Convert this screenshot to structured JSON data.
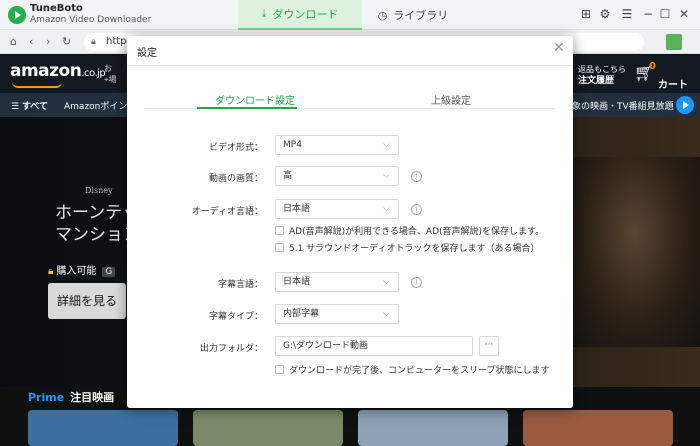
{
  "app": {
    "name": "TuneBoto",
    "subtitle": "Amazon Video Downloader",
    "tabs": [
      {
        "label": "ダウンロード",
        "icon": "download-icon",
        "active": true
      },
      {
        "label": "ライブラリ",
        "icon": "clock-icon",
        "active": false
      }
    ],
    "window_icons": [
      "grid-icon",
      "gear-icon",
      "menu-icon",
      "minimize-icon",
      "maximize-icon",
      "close-icon"
    ],
    "accent_color": "#22a84a"
  },
  "browser": {
    "url": "https:"
  },
  "amazon": {
    "logo": "amazon",
    "logo_suffix": ".co.jp",
    "deliver_prefix": "お",
    "deliver_line2": "場",
    "orders_line1": "返品もこちら",
    "orders_line2": "注文履歴",
    "cart_count": "0",
    "cart_label": "カート",
    "nav_all": "すべて",
    "nav_points": "Amazonポイント",
    "nav_promo": "象の映画・TV番組見放題",
    "hero_title_top": "Disney",
    "hero_title_line1": "ホーンテッド",
    "hero_title_line2": "マンション",
    "buy_label": "購入可能",
    "buy_badge": "G",
    "details_button": "詳細を見る",
    "prime_label": "Prime",
    "section_title": "注目映画"
  },
  "modal": {
    "title": "設定",
    "tabs": [
      {
        "label": "ダウンロード設定",
        "active": true
      },
      {
        "label": "上級設定",
        "active": false
      }
    ],
    "video_format": {
      "label": "ビデオ形式：",
      "value": "MP4"
    },
    "video_quality": {
      "label": "動画の画質：",
      "value": "高"
    },
    "audio_language": {
      "label": "オーディオ言語：",
      "value": "日本語"
    },
    "audio_options": [
      {
        "label": "AD(音声解説)が利用できる場合、AD(音声解説)を保存します。",
        "checked": false
      },
      {
        "label": "5.1 サラウンドオーディオトラックを保存します（ある場合）",
        "checked": false
      }
    ],
    "subtitle_language": {
      "label": "字幕言語：",
      "value": "日本語"
    },
    "subtitle_type": {
      "label": "字幕タイプ：",
      "value": "内部字幕"
    },
    "output_folder": {
      "label": "出力フォルダ：",
      "value": "G:\\ダウンロード動画",
      "browse": "···"
    },
    "sleep_option": {
      "label": "ダウンロードが完了後、コンピューターをスリープ状態にします",
      "checked": false
    }
  }
}
